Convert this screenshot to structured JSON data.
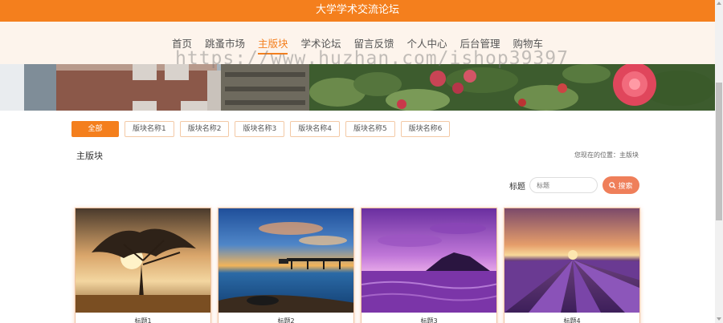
{
  "header": {
    "site_title": "大学学术交流论坛"
  },
  "nav": {
    "items": [
      "首页",
      "跳蚤市场",
      "主版块",
      "学术论坛",
      "留言反馈",
      "个人中心",
      "后台管理",
      "购物车"
    ],
    "active": "主版块"
  },
  "watermark": "https://www.huzhan.com/ishop39397",
  "filters": [
    "全部",
    "版块名称1",
    "版块名称2",
    "版块名称3",
    "版块名称4",
    "版块名称5",
    "版块名称6"
  ],
  "section": {
    "title": "主版块",
    "breadcrumb": "您现在的位置：主版块"
  },
  "search": {
    "label": "标题",
    "placeholder": "标题",
    "button": "搜索"
  },
  "cards": [
    {
      "title": "标题1",
      "image": "sunset-tree"
    },
    {
      "title": "标题2",
      "image": "seaside-pier"
    },
    {
      "title": "标题3",
      "image": "purple-sea"
    },
    {
      "title": "标题4",
      "image": "lavender-field"
    }
  ],
  "colors": {
    "accent": "#f47f1d",
    "search_button": "#ef7f5a",
    "nav_background": "#fdf4ec"
  }
}
